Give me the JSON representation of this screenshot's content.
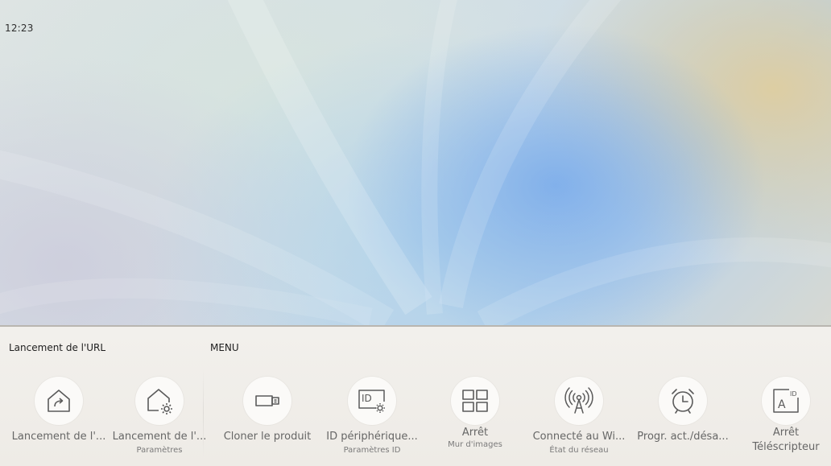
{
  "status": {
    "time": "12:23"
  },
  "sections": {
    "left_label": "Lancement de l'URL",
    "right_label": "MENU"
  },
  "tiles": [
    {
      "icon": "home-launch-icon",
      "title": "Lancement de l'...",
      "sub": ""
    },
    {
      "icon": "home-settings-icon",
      "title": "Lancement de l'...",
      "sub": "Paramètres"
    },
    {
      "icon": "clone-device-icon",
      "title": "Cloner le produit",
      "sub": ""
    },
    {
      "icon": "device-id-settings-icon",
      "title": "ID périphérique...",
      "sub": "Paramètres ID"
    },
    {
      "icon": "video-wall-icon",
      "title": "Arrêt",
      "sub": "Mur d'images"
    },
    {
      "icon": "wifi-broadcast-icon",
      "title": "Connecté au Wi...",
      "sub": "État du réseau"
    },
    {
      "icon": "alarm-clock-icon",
      "title": "Progr. act./désa...",
      "sub": ""
    },
    {
      "icon": "ticker-id-icon",
      "title": "Arrêt",
      "sub": "Téléscripteur"
    }
  ],
  "colors": {
    "panel_bg": "#eeebe6",
    "icon_stroke": "#5a5a5a",
    "text_primary": "#666666"
  }
}
